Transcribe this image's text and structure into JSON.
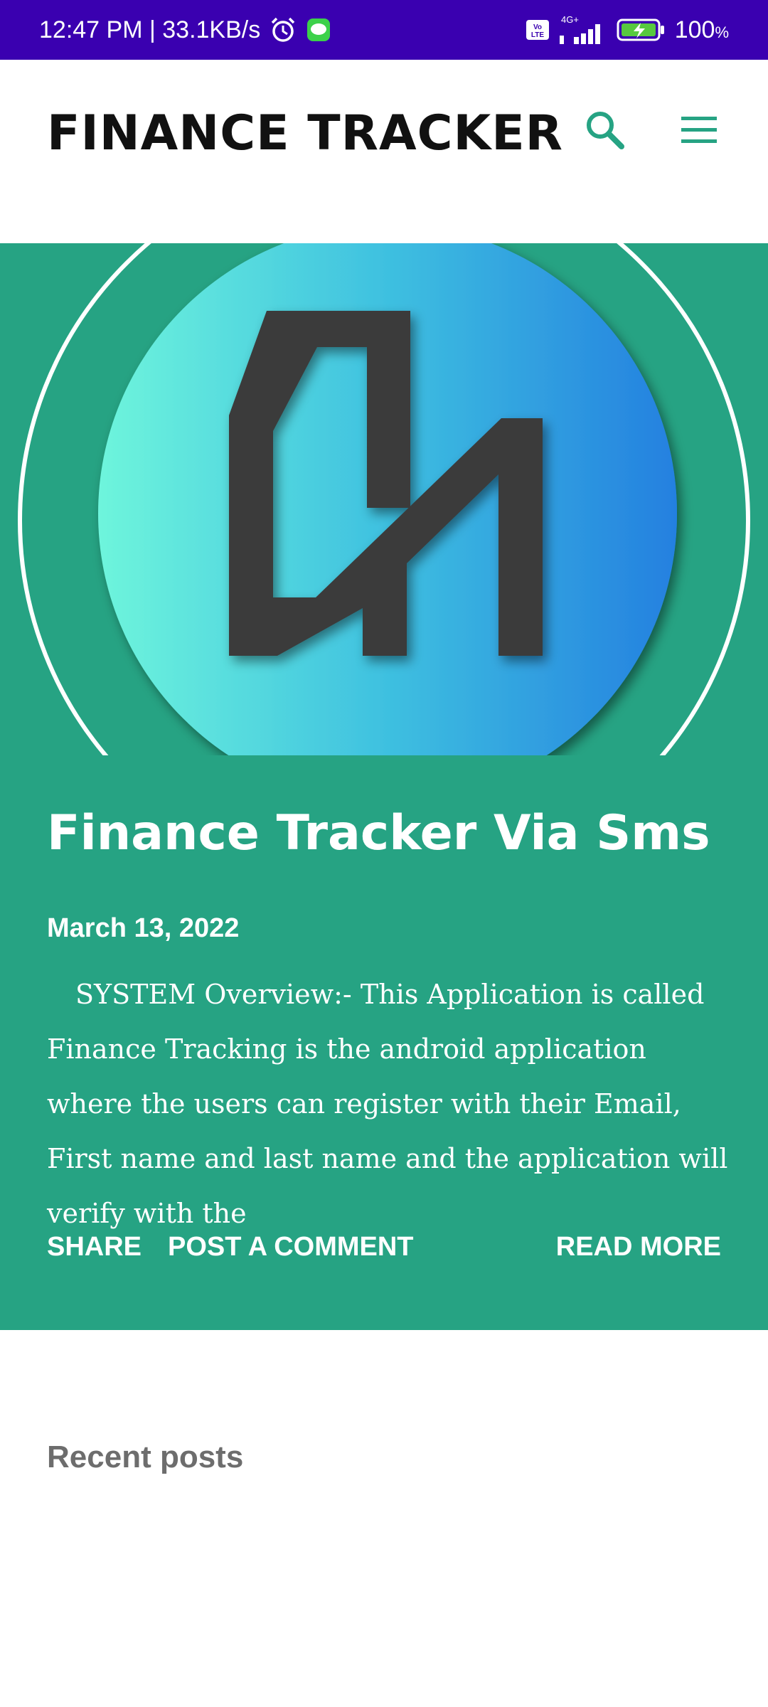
{
  "status_bar": {
    "time_and_speed": "12:47 PM | 33.1KB/s",
    "network": "4G+",
    "volte": "Vo LTE",
    "battery_percent": "100",
    "battery_unit": "%",
    "icons": [
      "alarm-icon",
      "message-icon",
      "signal-icon",
      "battery-charging-icon"
    ]
  },
  "header": {
    "title": "FINANCE TRACKER",
    "icons": [
      "search-icon",
      "menu-icon"
    ],
    "accent_color": "#26a383"
  },
  "post": {
    "title": "Finance Tracker Via Sms",
    "date": "March 13, 2022",
    "excerpt": "SYSTEM Overview:- This Application is called Finance Tracking is the android application where the users can register with their Email, First name and last name and the application will verify with the",
    "actions": {
      "share": "SHARE",
      "comment": "POST A COMMENT",
      "read_more": "READ MORE"
    },
    "background_color": "#26a383"
  },
  "sidebar": {
    "recent_heading": "Recent posts"
  }
}
